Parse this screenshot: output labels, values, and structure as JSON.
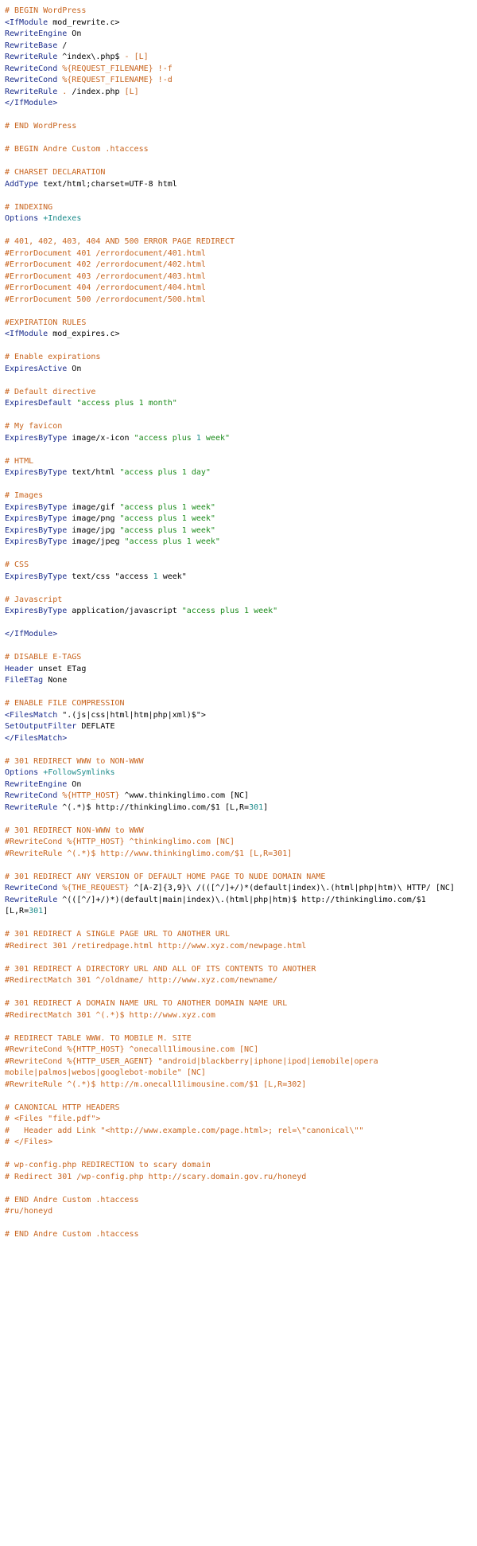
{
  "document": {
    "lines": [
      [
        {
          "t": "c",
          "v": "# BEGIN WordPress"
        }
      ],
      [
        {
          "t": "k",
          "v": "<IfModule"
        },
        {
          "t": "p",
          "v": " mod_rewrite.c>"
        }
      ],
      [
        {
          "t": "k",
          "v": "RewriteEngine"
        },
        {
          "t": "p",
          "v": " On"
        }
      ],
      [
        {
          "t": "k",
          "v": "RewriteBase"
        },
        {
          "t": "p",
          "v": " /"
        }
      ],
      [
        {
          "t": "k",
          "v": "RewriteRule"
        },
        {
          "t": "p",
          "v": " ^index\\.php$ "
        },
        {
          "t": "b",
          "v": "- [L]"
        }
      ],
      [
        {
          "t": "k",
          "v": "RewriteCond"
        },
        {
          "t": "p",
          "v": " "
        },
        {
          "t": "b",
          "v": "%{REQUEST_FILENAME} !-f"
        }
      ],
      [
        {
          "t": "k",
          "v": "RewriteCond"
        },
        {
          "t": "p",
          "v": " "
        },
        {
          "t": "b",
          "v": "%{REQUEST_FILENAME} !-d"
        }
      ],
      [
        {
          "t": "k",
          "v": "RewriteRule"
        },
        {
          "t": "p",
          "v": " "
        },
        {
          "t": "b",
          "v": ". "
        },
        {
          "t": "p",
          "v": "/index.php "
        },
        {
          "t": "b",
          "v": "[L]"
        }
      ],
      [
        {
          "t": "k",
          "v": "</IfModule>"
        }
      ],
      [],
      [
        {
          "t": "c",
          "v": "# END WordPress"
        }
      ],
      [],
      [
        {
          "t": "c",
          "v": "# BEGIN Andre Custom .htaccess"
        }
      ],
      [],
      [
        {
          "t": "c",
          "v": "# CHARSET DECLARATION"
        }
      ],
      [
        {
          "t": "k",
          "v": "AddType"
        },
        {
          "t": "p",
          "v": " text/html;charset=UTF-8 html"
        }
      ],
      [],
      [
        {
          "t": "c",
          "v": "# INDEXING"
        }
      ],
      [
        {
          "t": "k",
          "v": "Options"
        },
        {
          "t": "p",
          "v": " "
        },
        {
          "t": "v",
          "v": "+Indexes"
        }
      ],
      [],
      [
        {
          "t": "c",
          "v": "# 401, 402, 403, 404 AND 500 ERROR PAGE REDIRECT"
        }
      ],
      [
        {
          "t": "c",
          "v": "#ErrorDocument 401 /errordocument/401.html"
        }
      ],
      [
        {
          "t": "c",
          "v": "#ErrorDocument 402 /errordocument/402.html"
        }
      ],
      [
        {
          "t": "c",
          "v": "#ErrorDocument 403 /errordocument/403.html"
        }
      ],
      [
        {
          "t": "c",
          "v": "#ErrorDocument 404 /errordocument/404.html"
        }
      ],
      [
        {
          "t": "c",
          "v": "#ErrorDocument 500 /errordocument/500.html"
        }
      ],
      [],
      [
        {
          "t": "c",
          "v": "#EXPIRATION RULES"
        }
      ],
      [
        {
          "t": "k",
          "v": "<IfModule"
        },
        {
          "t": "p",
          "v": " mod_expires.c>"
        }
      ],
      [],
      [
        {
          "t": "c",
          "v": "# Enable expirations"
        }
      ],
      [
        {
          "t": "k",
          "v": "ExpiresActive"
        },
        {
          "t": "p",
          "v": " On"
        }
      ],
      [],
      [
        {
          "t": "c",
          "v": "# Default directive"
        }
      ],
      [
        {
          "t": "k",
          "v": "ExpiresDefault"
        },
        {
          "t": "p",
          "v": " "
        },
        {
          "t": "s",
          "v": "\"access plus 1 month\""
        }
      ],
      [],
      [
        {
          "t": "c",
          "v": "# My favicon"
        }
      ],
      [
        {
          "t": "k",
          "v": "ExpiresByType"
        },
        {
          "t": "p",
          "v": " image/x-icon "
        },
        {
          "t": "s",
          "v": "\"access plus "
        },
        {
          "t": "n",
          "v": "1"
        },
        {
          "t": "s",
          "v": " week\""
        }
      ],
      [],
      [
        {
          "t": "c",
          "v": "# HTML"
        }
      ],
      [
        {
          "t": "k",
          "v": "ExpiresByType"
        },
        {
          "t": "p",
          "v": " text/html "
        },
        {
          "t": "s",
          "v": "\"access plus 1 day\""
        }
      ],
      [],
      [
        {
          "t": "c",
          "v": "# Images"
        }
      ],
      [
        {
          "t": "k",
          "v": "ExpiresByType"
        },
        {
          "t": "p",
          "v": " image/gif "
        },
        {
          "t": "s",
          "v": "\"access plus 1 week\""
        }
      ],
      [
        {
          "t": "k",
          "v": "ExpiresByType"
        },
        {
          "t": "p",
          "v": " image/png "
        },
        {
          "t": "s",
          "v": "\"access plus 1 week\""
        }
      ],
      [
        {
          "t": "k",
          "v": "ExpiresByType"
        },
        {
          "t": "p",
          "v": " image/jpg "
        },
        {
          "t": "s",
          "v": "\"access plus 1 week\""
        }
      ],
      [
        {
          "t": "k",
          "v": "ExpiresByType"
        },
        {
          "t": "p",
          "v": " image/jpeg "
        },
        {
          "t": "s",
          "v": "\"access plus 1 week\""
        }
      ],
      [],
      [
        {
          "t": "c",
          "v": "# CSS"
        }
      ],
      [
        {
          "t": "k",
          "v": "ExpiresByType"
        },
        {
          "t": "p",
          "v": " text/css "
        },
        {
          "t": "p",
          "v": "\"access "
        },
        {
          "t": "n",
          "v": "1"
        },
        {
          "t": "p",
          "v": " week\""
        }
      ],
      [],
      [
        {
          "t": "c",
          "v": "# Javascript"
        }
      ],
      [
        {
          "t": "k",
          "v": "ExpiresByType"
        },
        {
          "t": "p",
          "v": " application/javascript "
        },
        {
          "t": "s",
          "v": "\"access plus 1 week\""
        }
      ],
      [],
      [
        {
          "t": "k",
          "v": "</IfModule>"
        }
      ],
      [],
      [
        {
          "t": "c",
          "v": "# DISABLE E-TAGS"
        }
      ],
      [
        {
          "t": "k",
          "v": "Header"
        },
        {
          "t": "p",
          "v": " unset ETag"
        }
      ],
      [
        {
          "t": "k",
          "v": "FileETag"
        },
        {
          "t": "p",
          "v": " None"
        }
      ],
      [],
      [
        {
          "t": "c",
          "v": "# ENABLE FILE COMPRESSION"
        }
      ],
      [
        {
          "t": "k",
          "v": "<FilesMatch"
        },
        {
          "t": "p",
          "v": " \".(js|css|html|htm|php|xml)$\">"
        }
      ],
      [
        {
          "t": "k",
          "v": "SetOutputFilter"
        },
        {
          "t": "p",
          "v": " DEFLATE"
        }
      ],
      [
        {
          "t": "k",
          "v": "</FilesMatch>"
        }
      ],
      [],
      [
        {
          "t": "c",
          "v": "# 301 REDIRECT WWW to NON-WWW"
        }
      ],
      [
        {
          "t": "k",
          "v": "Options"
        },
        {
          "t": "p",
          "v": " "
        },
        {
          "t": "v",
          "v": "+FollowSymlinks"
        }
      ],
      [
        {
          "t": "k",
          "v": "RewriteEngine"
        },
        {
          "t": "p",
          "v": " On"
        }
      ],
      [
        {
          "t": "k",
          "v": "RewriteCond"
        },
        {
          "t": "p",
          "v": " "
        },
        {
          "t": "b",
          "v": "%{HTTP_HOST}"
        },
        {
          "t": "p",
          "v": " ^www.thinkinglimo.com [NC]"
        }
      ],
      [
        {
          "t": "k",
          "v": "RewriteRule"
        },
        {
          "t": "p",
          "v": " ^(.*)$ http://thinkinglimo.com/$1 [L,R="
        },
        {
          "t": "n",
          "v": "301"
        },
        {
          "t": "p",
          "v": "]"
        }
      ],
      [],
      [
        {
          "t": "c",
          "v": "# 301 REDIRECT NON-WWW to WWW"
        }
      ],
      [
        {
          "t": "c",
          "v": "#RewriteCond %{HTTP_HOST} ^thinkinglimo.com [NC]"
        }
      ],
      [
        {
          "t": "c",
          "v": "#RewriteRule ^(.*)$ http://www.thinkinglimo.com/$1 [L,R=301]"
        }
      ],
      [],
      [
        {
          "t": "c",
          "v": "# 301 REDIRECT ANY VERSION OF DEFAULT HOME PAGE TO NUDE DOMAIN NAME"
        }
      ],
      [
        {
          "t": "k",
          "v": "RewriteCond"
        },
        {
          "t": "p",
          "v": " "
        },
        {
          "t": "b",
          "v": "%{THE_REQUEST}"
        },
        {
          "t": "p",
          "v": " ^[A-Z]{3,9}\\ /(([^/]+/)*(default|index)\\.(html|php|htm)\\ HTTP/ [NC]"
        }
      ],
      [
        {
          "t": "k",
          "v": "RewriteRule"
        },
        {
          "t": "p",
          "v": " ^(([^/]+/)*)(default|main|index)\\.(html|php|htm)$ http://thinkinglimo.com/$1 [L,R="
        },
        {
          "t": "n",
          "v": "301"
        },
        {
          "t": "p",
          "v": "]"
        }
      ],
      [],
      [
        {
          "t": "c",
          "v": "# 301 REDIRECT A SINGLE PAGE URL TO ANOTHER URL"
        }
      ],
      [
        {
          "t": "c",
          "v": "#Redirect 301 /retiredpage.html http://www.xyz.com/newpage.html"
        }
      ],
      [],
      [
        {
          "t": "c",
          "v": "# 301 REDIRECT A DIRECTORY URL AND ALL OF ITS CONTENTS TO ANOTHER"
        }
      ],
      [
        {
          "t": "c",
          "v": "#RedirectMatch 301 ^/oldname/ http://www.xyz.com/newname/"
        }
      ],
      [],
      [
        {
          "t": "c",
          "v": "# 301 REDIRECT A DOMAIN NAME URL TO ANOTHER DOMAIN NAME URL"
        }
      ],
      [
        {
          "t": "c",
          "v": "#RedirectMatch 301 ^(.*)$ http://www.xyz.com"
        }
      ],
      [],
      [
        {
          "t": "c",
          "v": "# REDIRECT TABLE WWW. TO MOBILE M. SITE"
        }
      ],
      [
        {
          "t": "c",
          "v": "#RewriteCond %{HTTP_HOST} ^onecall1limousine.com [NC]"
        }
      ],
      [
        {
          "t": "c",
          "v": "#RewriteCond %{HTTP_USER_AGENT} \"android|blackberry|iphone|ipod|iemobile|opera mobile|palmos|webos|googlebot-mobile\" [NC]"
        }
      ],
      [
        {
          "t": "c",
          "v": "#RewriteRule ^(.*)$ http://m.onecall1limousine.com/$1 [L,R=302]"
        }
      ],
      [],
      [
        {
          "t": "c",
          "v": "# CANONICAL HTTP HEADERS"
        }
      ],
      [
        {
          "t": "c",
          "v": "# <Files \"file.pdf\">"
        }
      ],
      [
        {
          "t": "c",
          "v": "#   Header add Link \"<http://www.example.com/page.html>; rel=\\\"canonical\\\"\""
        }
      ],
      [
        {
          "t": "c",
          "v": "# </Files>"
        }
      ],
      [],
      [
        {
          "t": "c",
          "v": "# wp-config.php REDIRECTION to scary domain"
        }
      ],
      [
        {
          "t": "c",
          "v": "# Redirect 301 /wp-config.php http://scary.domain.gov.ru/honeyd"
        }
      ],
      [],
      [
        {
          "t": "c",
          "v": "# END Andre Custom .htaccess"
        }
      ],
      [
        {
          "t": "c",
          "v": "#ru/honeyd"
        }
      ],
      [],
      [
        {
          "t": "c",
          "v": "# END Andre Custom .htaccess"
        }
      ]
    ]
  }
}
